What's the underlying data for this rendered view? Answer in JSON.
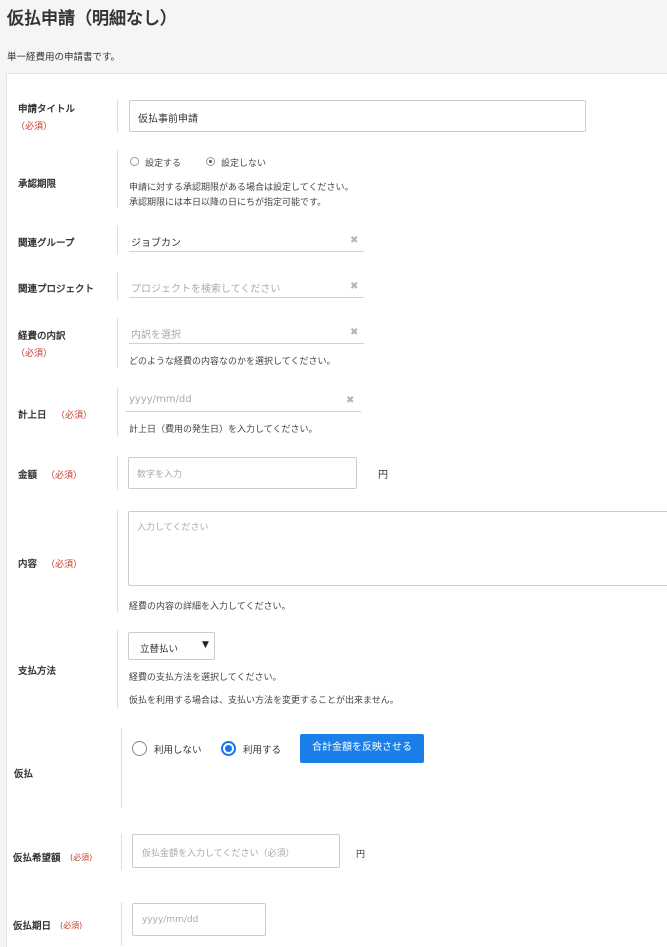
{
  "page": {
    "title": "仮払申請（明細なし）",
    "description": "単一経費用の申請書です。"
  },
  "form": {
    "required_mark": "（必須）",
    "required_mark_small": "(必須)",
    "application_title": {
      "label": "申請タイトル",
      "value": "仮払事前申請"
    },
    "approval_deadline": {
      "label": "承認期限",
      "options": [
        "設定する",
        "設定しない"
      ],
      "selected": "設定しない",
      "help1": "申請に対する承認期限がある場合は設定してください。",
      "help2": "承認期限には本日以降の日にちが指定可能です。"
    },
    "related_group": {
      "label": "関連グループ",
      "value": "ジョブカン",
      "clear_icon": "x-icon"
    },
    "related_project": {
      "label": "関連プロジェクト",
      "placeholder": "プロジェクトを検索してください",
      "clear_icon": "x-icon"
    },
    "expense_breakdown": {
      "label": "経費の内訳",
      "placeholder": "内訳を選択",
      "help": "どのような経費の内容なのかを選択してください。"
    },
    "posting_date": {
      "label": "計上日",
      "placeholder": "yyyy/mm/dd",
      "help": "計上日（費用の発生日）を入力してください。"
    },
    "amount": {
      "label": "金額",
      "placeholder": "数字を入力",
      "unit": "円"
    },
    "content": {
      "label": "内容",
      "placeholder": "入力してください",
      "help": "経費の内容の詳細を入力してください。"
    },
    "payment_method": {
      "label": "支払方法",
      "selected": "立替払い",
      "arrow": "▼",
      "help1": "経費の支払方法を選択してください。",
      "help2": "仮払を利用する場合は、支払い方法を変更することが出来ません。"
    },
    "advance": {
      "label": "仮払",
      "options": [
        "利用しない",
        "利用する"
      ],
      "selected": "利用する",
      "reflect_button": "合計金額を反映させる"
    },
    "advance_amount": {
      "label": "仮払希望額",
      "placeholder": "仮払金額を入力してください（必須）",
      "unit": "円"
    },
    "advance_date": {
      "label": "仮払期日",
      "placeholder": "yyyy/mm/dd"
    }
  }
}
